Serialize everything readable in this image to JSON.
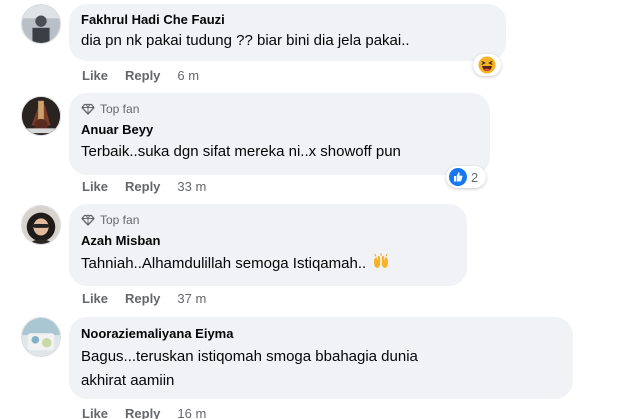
{
  "comments": [
    {
      "author": "Fakhrul Hadi Che Fauzi",
      "badge": "",
      "text": "dia pn nk pakai tudung ?? biar bini dia jela pakai..",
      "like_label": "Like",
      "reply_label": "Reply",
      "time": "6 m",
      "reaction": {
        "icon": "laughing-emoji-icon",
        "count": ""
      }
    },
    {
      "author": "Anuar Beyy",
      "badge": "Top fan",
      "text": "Terbaik..suka dgn sifat mereka ni..x showoff pun",
      "like_label": "Like",
      "reply_label": "Reply",
      "time": "33 m",
      "reaction": {
        "icon": "like-reaction-icon",
        "count": "2"
      }
    },
    {
      "author": "Azah Misban",
      "badge": "Top fan",
      "text": "Tahniah..Alhamdulillah semoga Istiqamah..",
      "like_label": "Like",
      "reply_label": "Reply",
      "time": "37 m",
      "reaction": null
    },
    {
      "author": "Nooraziemaliyana Eiyma",
      "badge": "",
      "text_line1": "Bagus...teruskan istiqomah smoga bbahagia dunia",
      "text_line2": "akhirat aamiin",
      "like_label": "Like",
      "reply_label": "Reply",
      "time": "16 m",
      "reaction": null
    }
  ],
  "colors": {
    "bubble": "#f0f2f5",
    "secondary_text": "#65676b",
    "primary_text": "#050505",
    "like_blue": "#1877f2"
  }
}
